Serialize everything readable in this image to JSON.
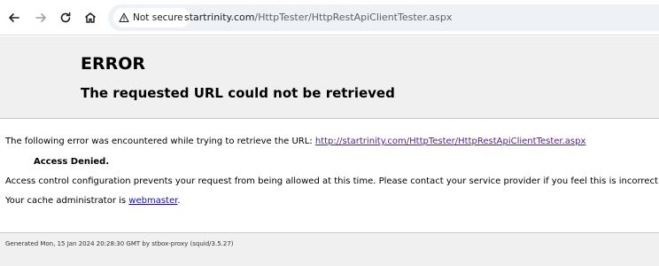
{
  "browser": {
    "security_label": "Not secure",
    "url_host": "startrinity.com",
    "url_path": "/HttpTester/HttpRestApiClientTester.aspx"
  },
  "error_page": {
    "heading": "ERROR",
    "subheading": "The requested URL could not be retrieved",
    "intro_text": "The following error was encountered while trying to retrieve the URL: ",
    "requested_url": "http://startrinity.com/HttpTester/HttpRestApiClientTester.aspx",
    "error_name": "Access Denied.",
    "explanation": "Access control configuration prevents your request from being allowed at this time. Please contact your service provider if you feel this is incorrect.",
    "admin_prefix": "Your cache administrator is ",
    "admin_link": "webmaster",
    "admin_suffix": ".",
    "footer": "Generated Mon, 15 Jan 2024 20:28:30 GMT by stbox-proxy (squid/3.5.27)"
  },
  "colors": {
    "link": "#1a0dab",
    "visited_link": "#551a8b",
    "header_bg": "#f0f0f0"
  }
}
